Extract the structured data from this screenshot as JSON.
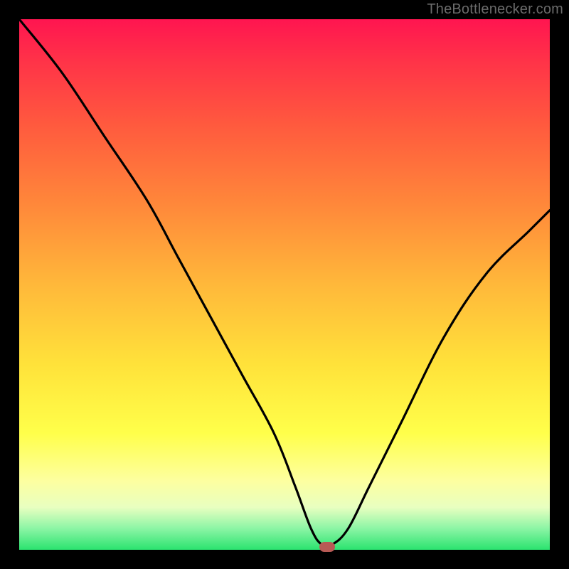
{
  "watermark": "TheBottlenecker.com",
  "chart_data": {
    "type": "line",
    "title": "",
    "xlabel": "",
    "ylabel": "",
    "xlim": [
      0,
      100
    ],
    "ylim": [
      0,
      100
    ],
    "grid": false,
    "series": [
      {
        "name": "bottleneck-curve",
        "x": [
          0,
          8,
          16,
          24,
          30,
          36,
          42,
          48,
          52,
          55,
          57,
          59,
          62,
          66,
          72,
          80,
          88,
          96,
          100
        ],
        "y": [
          100,
          90,
          78,
          66,
          55,
          44,
          33,
          22,
          12,
          4,
          1,
          1,
          4,
          12,
          24,
          40,
          52,
          60,
          64
        ]
      }
    ],
    "marker": {
      "x": 58,
      "y": 0.5,
      "color": "#b85a55"
    }
  }
}
